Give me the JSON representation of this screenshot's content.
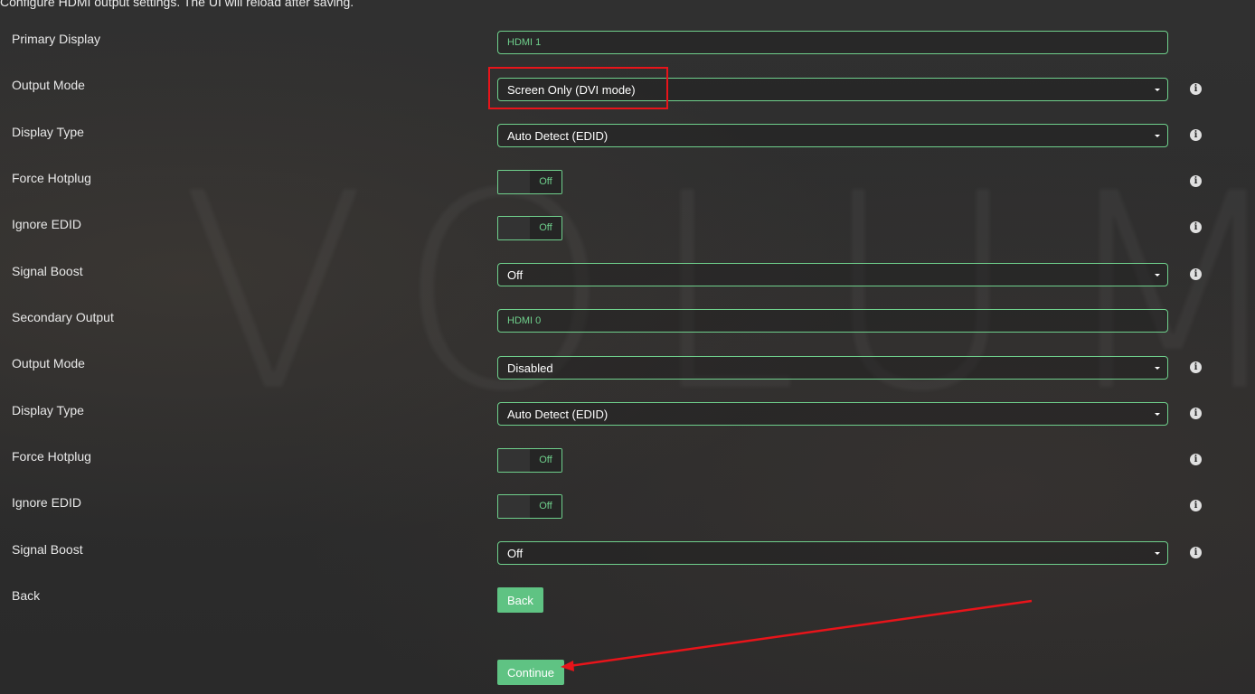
{
  "header": {
    "description": "Configure HDMI output settings. The UI will reload after saving."
  },
  "rows": [
    {
      "label": "Primary Display",
      "kind": "text",
      "value": "HDMI 1",
      "info": false
    },
    {
      "label": "Output Mode",
      "kind": "select",
      "value": "Screen Only (DVI mode)",
      "info": true
    },
    {
      "label": "Display Type",
      "kind": "select",
      "value": "Auto Detect (EDID)",
      "info": true
    },
    {
      "label": "Force Hotplug",
      "kind": "toggle",
      "value": "Off",
      "info": true
    },
    {
      "label": "Ignore EDID",
      "kind": "toggle",
      "value": "Off",
      "info": true
    },
    {
      "label": "Signal Boost",
      "kind": "select",
      "value": "Off",
      "info": true
    },
    {
      "label": "Secondary Output",
      "kind": "text",
      "value": "HDMI 0",
      "info": false
    },
    {
      "label": "Output Mode",
      "kind": "select",
      "value": "Disabled",
      "info": true
    },
    {
      "label": "Display Type",
      "kind": "select",
      "value": "Auto Detect (EDID)",
      "info": true
    },
    {
      "label": "Force Hotplug",
      "kind": "toggle",
      "value": "Off",
      "info": true
    },
    {
      "label": "Ignore EDID",
      "kind": "toggle",
      "value": "Off",
      "info": true
    },
    {
      "label": "Signal Boost",
      "kind": "select",
      "value": "Off",
      "info": true
    },
    {
      "label": "Back",
      "kind": "button",
      "value": "Back",
      "info": false
    }
  ],
  "continue_button": {
    "label": "Continue"
  },
  "info_icon_glyph": "i",
  "watermark_text": "VOLUMIO",
  "colors": {
    "accent": "#6fd08c",
    "button": "#5fc383",
    "annotation": "#e8141a",
    "background": "#2c2c2c"
  }
}
